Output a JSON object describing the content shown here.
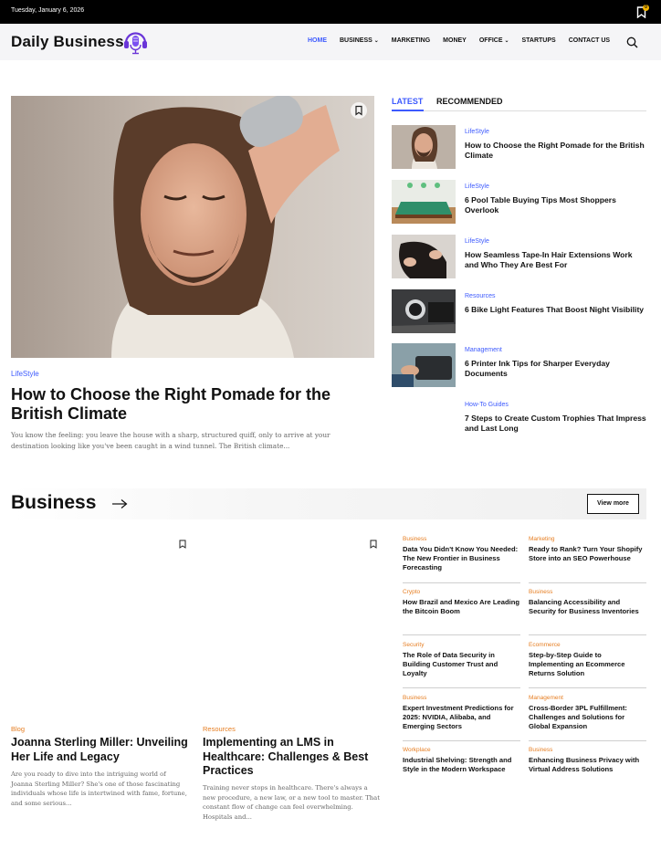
{
  "topbar": {
    "date": "Tuesday, January 6, 2026",
    "bookmark_count": "0"
  },
  "header": {
    "logo": "Daily Business",
    "nav": [
      {
        "label": "HOME"
      },
      {
        "label": "BUSINESS"
      },
      {
        "label": "MARKETING"
      },
      {
        "label": "MONEY"
      },
      {
        "label": "OFFICE"
      },
      {
        "label": "STARTUPS"
      },
      {
        "label": "CONTACT US"
      }
    ]
  },
  "hero": {
    "category": "LifeStyle",
    "title": "How to Choose the Right Pomade for the British Climate",
    "excerpt": "You know the feeling: you leave the house with a sharp, structured quiff, only to arrive at your destination looking like you've been caught in a wind tunnel. The British climate..."
  },
  "tabs": {
    "latest": "LATEST",
    "recommended": "RECOMMENDED"
  },
  "latest": [
    {
      "category": "LifeStyle",
      "title": "How to Choose the Right Pomade for the British Climate"
    },
    {
      "category": "LifeStyle",
      "title": "6 Pool Table Buying Tips Most Shoppers Overlook"
    },
    {
      "category": "LifeStyle",
      "title": "How Seamless Tape-In Hair Extensions Work and Who They Are Best For"
    },
    {
      "category": "Resources",
      "title": "6 Bike Light Features That Boost Night Visibility"
    },
    {
      "category": "Management",
      "title": "6 Printer Ink Tips for Sharper Everyday Documents"
    },
    {
      "category": "How-To Guides",
      "title": "7 Steps to Create Custom Trophies That Impress and Last Long"
    }
  ],
  "business": {
    "title": "Business",
    "view_more": "View more",
    "cards": [
      {
        "category": "Blog",
        "title": "Joanna Sterling Miller: Unveiling Her Life and Legacy",
        "excerpt": "Are you ready to dive into the intriguing world of Joanna Sterling Miller? She's one of those fascinating individuals whose life is intertwined with fame, fortune, and some serious..."
      },
      {
        "category": "Resources",
        "title": "Implementing an LMS in Healthcare: Challenges & Best Practices",
        "excerpt": "Training never stops in healthcare. There's always a new procedure, a new law, or a new tool to master. That constant flow of change can feel overwhelming. Hospitals and..."
      }
    ],
    "mini_left": [
      {
        "category": "Business",
        "title": "Data You Didn't Know You Needed: The New Frontier in Business Forecasting"
      },
      {
        "category": "Crypto",
        "title": "How Brazil and Mexico Are Leading the Bitcoin Boom"
      },
      {
        "category": "Security",
        "title": "The Role of Data Security in Building Customer Trust and Loyalty"
      },
      {
        "category": "Business",
        "title": "Expert Investment Predictions for 2025: NVIDIA, Alibaba, and Emerging Sectors"
      },
      {
        "category": "Workplace",
        "title": "Industrial Shelving: Strength and Style in the Modern Workspace"
      }
    ],
    "mini_right": [
      {
        "category": "Marketing",
        "title": "Ready to Rank? Turn Your Shopify Store into an SEO Powerhouse"
      },
      {
        "category": "Business",
        "title": "Balancing Accessibility and Security for Business Inventories"
      },
      {
        "category": "Ecommerce",
        "title": "Step-by-Step Guide to Implementing an Ecommerce Returns Solution"
      },
      {
        "category": "Management",
        "title": "Cross-Border 3PL Fulfillment: Challenges and Solutions for Global Expansion"
      },
      {
        "category": "Business",
        "title": "Enhancing Business Privacy with Virtual Address Solutions"
      }
    ]
  },
  "colors": {
    "accent": "#3d5afe",
    "category_orange": "#e67e22",
    "topbar": "#000000"
  }
}
